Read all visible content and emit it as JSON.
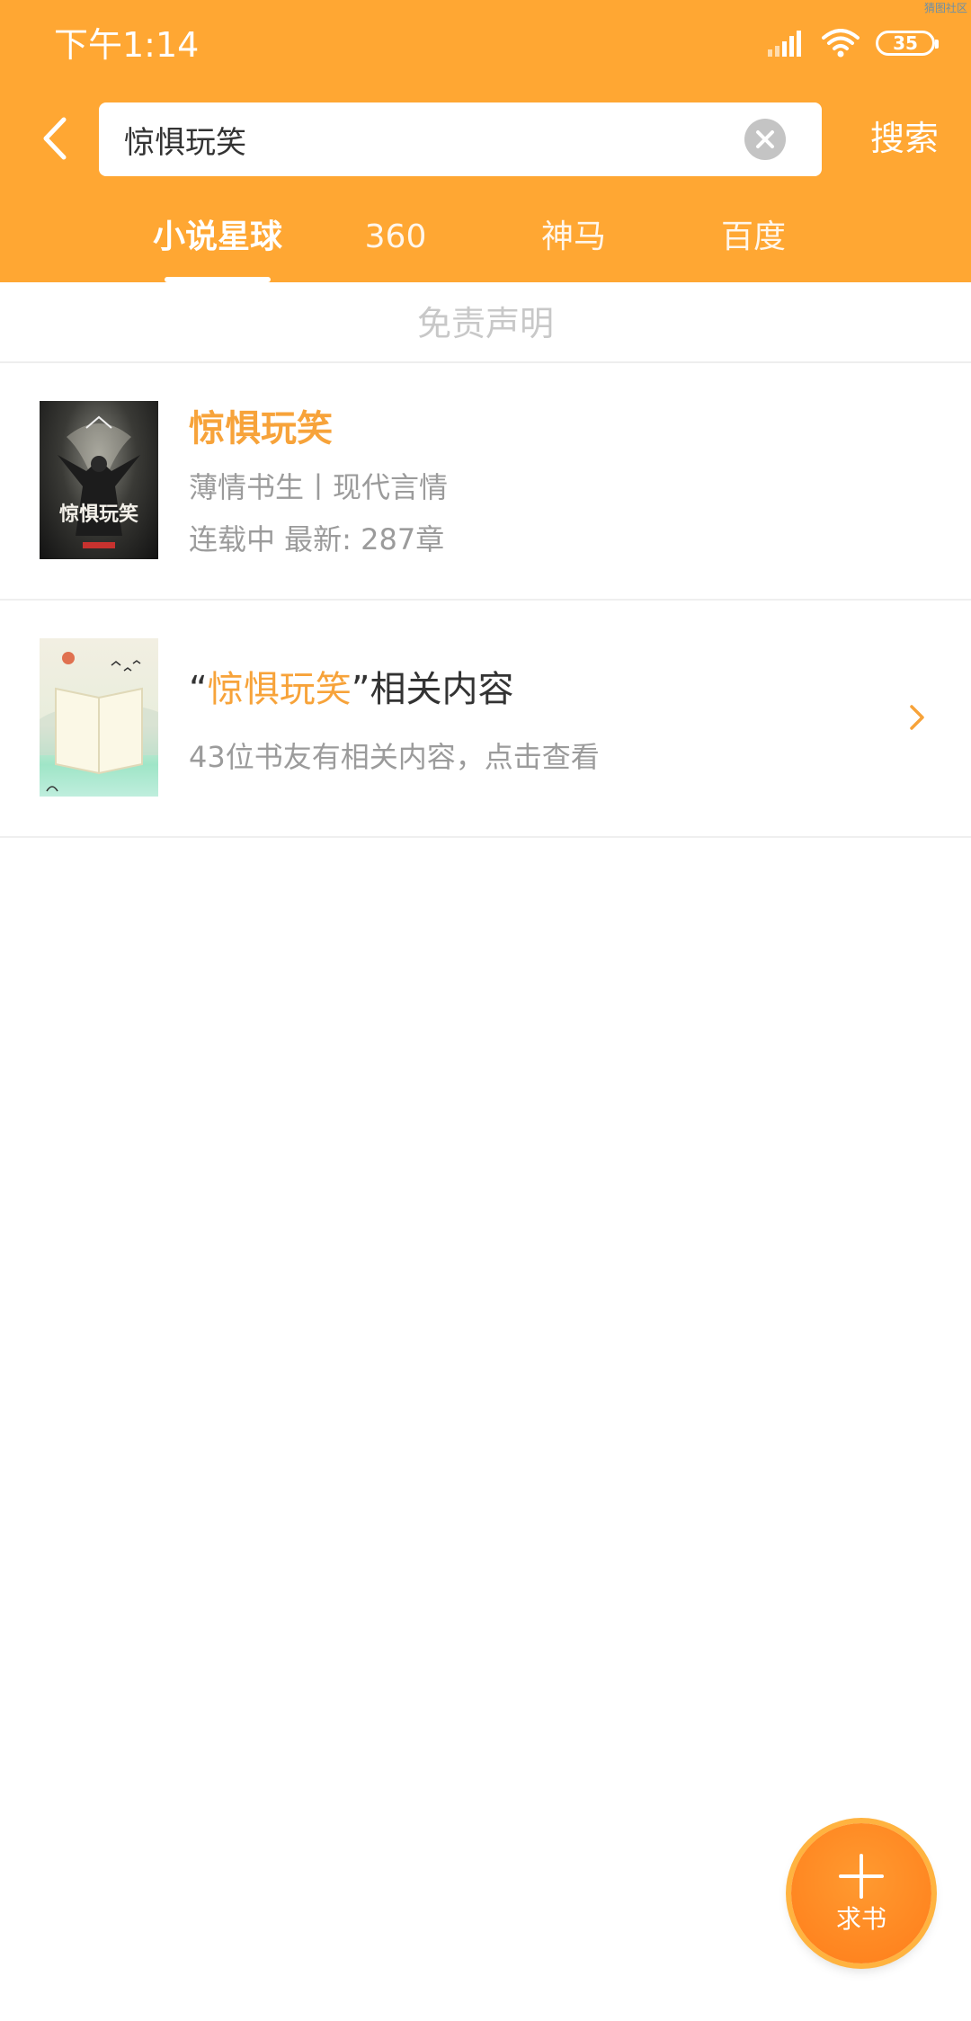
{
  "status_bar": {
    "time": "下午1:14",
    "battery": "35",
    "corner_mark": "猜图社区",
    "icons": [
      "signal-icon",
      "wifi-icon",
      "battery-icon"
    ]
  },
  "header": {
    "back_icon": "back-arrow-icon",
    "search": {
      "value": "惊惧玩笑",
      "clear_icon": "clear-icon"
    },
    "search_button": "搜索"
  },
  "tabs": [
    {
      "label": "小说星球",
      "active": true
    },
    {
      "label": "360",
      "active": false
    },
    {
      "label": "神马",
      "active": false
    },
    {
      "label": "百度",
      "active": false
    }
  ],
  "disclaimer": "免责声明",
  "results": [
    {
      "title": "惊惧玩笑",
      "meta": "薄情书生丨现代言情",
      "status": "连载中 最新: 287章",
      "cover_text": "惊惧玩笑"
    },
    {
      "title_prefix": "“",
      "title_highlight": "惊惧玩笑",
      "title_suffix": "”相关内容",
      "desc": "43位书友有相关内容，点击查看",
      "chevron_icon": "chevron-right-icon"
    }
  ],
  "fab": {
    "label": "求书",
    "icon": "plus-icon"
  },
  "colors": {
    "accent": "#FFA733",
    "highlight": "#F7A33A",
    "fab": "#FF8A20"
  }
}
